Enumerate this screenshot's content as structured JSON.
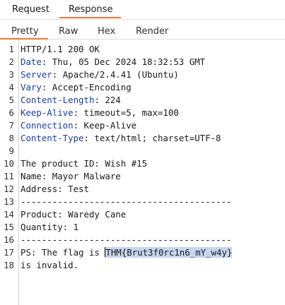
{
  "top_tabs": {
    "request": "Request",
    "response": "Response"
  },
  "sub_tabs": {
    "pretty": "Pretty",
    "raw": "Raw",
    "hex": "Hex",
    "render": "Render"
  },
  "lines": [
    {
      "num": "1",
      "plain": "HTTP/1.1 200 OK"
    },
    {
      "num": "2",
      "name": "Date",
      "value": " Thu, 05 Dec 2024 18:32:53 GMT"
    },
    {
      "num": "3",
      "name": "Server",
      "value": " Apache/2.4.41 (Ubuntu)"
    },
    {
      "num": "4",
      "name": "Vary",
      "value": " Accept-Encoding"
    },
    {
      "num": "5",
      "name": "Content-Length",
      "value": " 224"
    },
    {
      "num": "6",
      "name": "Keep-Alive",
      "value": " timeout=5, max=100"
    },
    {
      "num": "7",
      "name": "Connection",
      "value": " Keep-Alive"
    },
    {
      "num": "8",
      "name": "Content-Type",
      "value": " text/html; charset=UTF-8"
    },
    {
      "num": "9",
      "plain": ""
    },
    {
      "num": "10",
      "plain": "The product ID: Wish #15"
    },
    {
      "num": "11",
      "plain": "Name: Mayor Malware"
    },
    {
      "num": "12",
      "plain": "Address: Test"
    },
    {
      "num": "13",
      "plain": "----------------------------------------"
    },
    {
      "num": "14",
      "plain": "Product: Waredy Cane"
    },
    {
      "num": "15",
      "plain": "Quantity: 1"
    },
    {
      "num": "16",
      "plain": "----------------------------------------"
    },
    {
      "num": "17",
      "prefix": "PS: The flag is ",
      "flag": "THM{Brut3f0rc1n6_mY_w4y}"
    },
    {
      "num": "18",
      "plain": "is invalid."
    }
  ],
  "colors": {
    "accent": "#e8773a",
    "header_name": "#1b3ea8",
    "selection": "#c5d6ee"
  }
}
